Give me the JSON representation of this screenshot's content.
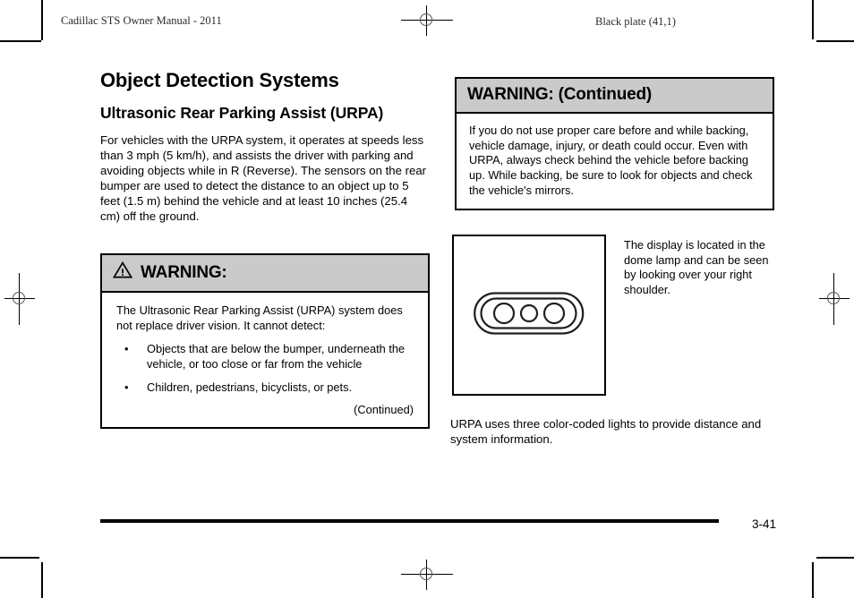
{
  "page": {
    "running_head_left": "Cadillac STS Owner Manual - 2011",
    "running_head_right": "Black plate (41,1)",
    "page_number": "3-41"
  },
  "left_column": {
    "title": "Object Detection Systems",
    "subtitle": "Ultrasonic Rear Parking Assist (URPA)",
    "intro_paragraph": "For vehicles with the URPA system, it operates at speeds less than 3 mph (5 km/h), and assists the driver with parking and avoiding objects while in R (Reverse). The sensors on the rear bumper are used to detect the distance to an object up to 5 feet (1.5 m) behind the vehicle and at least 10 inches (25.4 cm) off the ground.",
    "warning": {
      "icon": "warning-triangle-icon",
      "heading": "WARNING:",
      "body": "The Ultrasonic Rear Parking Assist (URPA) system does not replace driver vision. It cannot detect:",
      "bullet_marker": "•",
      "bullets": [
        "Objects that are below the bumper, underneath the vehicle, or too close or far from the vehicle",
        "Children, pedestrians, bicyclists, or pets."
      ],
      "continued_label": "(Continued)"
    }
  },
  "right_column": {
    "warning_continued": {
      "heading": "WARNING:  (Continued)",
      "body": "If you do not use proper care before and while backing, vehicle damage, injury, or death could occur. Even with URPA, always check behind the vehicle before backing up. While backing, be sure to look for objects and check the vehicle's mirrors."
    },
    "figure": {
      "icon": "urpa-dome-lamp-display-icon",
      "caption": "The display is located in the dome lamp and can be seen by looking over your right shoulder."
    },
    "note_paragraph": "URPA uses three color-coded lights to provide distance and system information."
  },
  "print_marks": {
    "corner_marks": "crop-marks",
    "registration_targets": "registration-target-icon"
  },
  "colors": {
    "warning_header_fill": "#cacaca",
    "rule": "#000000",
    "text": "#000000"
  }
}
